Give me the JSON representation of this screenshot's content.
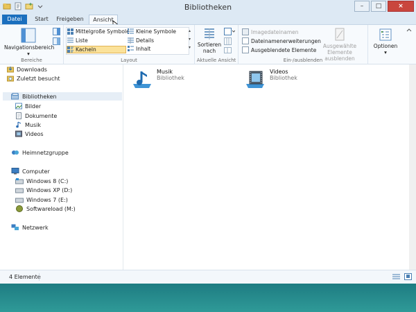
{
  "window": {
    "title": "Bibliotheken",
    "buttons": {
      "minimize": "–",
      "maximize": "□",
      "close": "×"
    }
  },
  "tabs": [
    {
      "label": "Datei"
    },
    {
      "label": "Start"
    },
    {
      "label": "Freigeben"
    },
    {
      "label": "Ansicht"
    }
  ],
  "ribbon": {
    "bereiche": {
      "label": "Bereiche",
      "navigationsbereich": "Navigationsbereich"
    },
    "layout": {
      "label": "Layout",
      "options": [
        {
          "label": "Mittelgroße Symbole"
        },
        {
          "label": "Liste"
        },
        {
          "label": "Kacheln"
        },
        {
          "label": "Kleine Symbole"
        },
        {
          "label": "Details"
        },
        {
          "label": "Inhalt"
        }
      ]
    },
    "aktuelle_ansicht": {
      "label": "Aktuelle Ansicht",
      "sortieren": "Sortieren nach"
    },
    "ein_ausblenden": {
      "label": "Ein-/ausblenden",
      "imagedateinamen": "Imagedateinamen",
      "dateinamenerweiterungen": "Dateinamenerweiterungen",
      "ausgeblendete": "Ausgeblendete Elemente",
      "ausgewaehlte": "Ausgewählte Elemente ausblenden"
    },
    "optionen": "Optionen"
  },
  "nav": {
    "downloads": "Downloads",
    "zuletzt": "Zuletzt besucht",
    "bibliotheken": "Bibliotheken",
    "bilder": "Bilder",
    "dokumente": "Dokumente",
    "musik": "Musik",
    "videos": "Videos",
    "heimnetzgruppe": "Heimnetzgruppe",
    "computer": "Computer",
    "drives": [
      {
        "label": "Windows 8 (C:)"
      },
      {
        "label": "Windows XP (D:)"
      },
      {
        "label": "Windows 7 (E:)"
      },
      {
        "label": "Softwareload (M:)"
      }
    ],
    "netzwerk": "Netzwerk"
  },
  "items": [
    {
      "name": "Musik",
      "type": "Bibliothek"
    },
    {
      "name": "Videos",
      "type": "Bibliothek"
    }
  ],
  "status": {
    "count": "4 Elemente"
  },
  "colors": {
    "accent": "#1b6fbe",
    "selected_bg": "#fbe29a",
    "desktop": "#2f8a8a"
  }
}
